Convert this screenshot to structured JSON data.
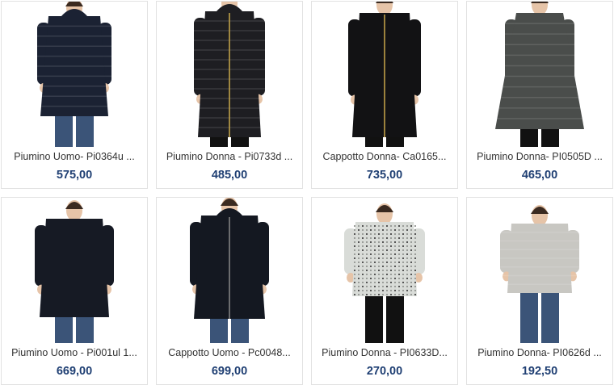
{
  "products": [
    {
      "name": "Piumino Uomo- Pi0364u ...",
      "price": "575,00",
      "coat": "#1b2233",
      "kind": "puffer-man"
    },
    {
      "name": "Piumino Donna - Pi0733d ...",
      "price": "485,00",
      "coat": "#1e1e22",
      "kind": "puffer-long"
    },
    {
      "name": "Cappotto Donna- Ca0165...",
      "price": "735,00",
      "coat": "#121214",
      "kind": "coat-woman"
    },
    {
      "name": "Piumino Donna- PI0505D ...",
      "price": "465,00",
      "coat": "#4a4d4b",
      "kind": "puffer-flare"
    },
    {
      "name": "Piumino Uomo - Pi001ul 1...",
      "price": "669,00",
      "coat": "#161a24",
      "kind": "coat-man"
    },
    {
      "name": "Cappotto Uomo - Pc0048...",
      "price": "699,00",
      "coat": "#141821",
      "kind": "coat-man-hood"
    },
    {
      "name": "Piumino Donna - PI0633D...",
      "price": "270,00",
      "coat": "#d9dcd8",
      "kind": "tweed-jacket"
    },
    {
      "name": "Piumino Donna- PI0626d ...",
      "price": "192,50",
      "coat": "#c8c7c2",
      "kind": "puffer-short"
    }
  ]
}
